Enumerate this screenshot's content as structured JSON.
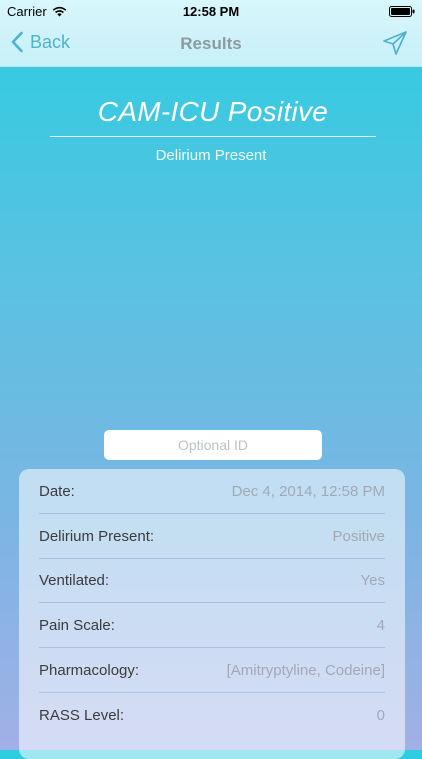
{
  "status_bar": {
    "carrier": "Carrier",
    "time": "12:58 PM"
  },
  "nav": {
    "back_label": "Back",
    "title": "Results"
  },
  "result": {
    "title": "CAM-ICU Positive",
    "subtitle": "Delirium Present"
  },
  "optional_id": {
    "placeholder": "Optional ID",
    "value": ""
  },
  "details": [
    {
      "label": "Date:",
      "value": "Dec 4, 2014, 12:58 PM"
    },
    {
      "label": "Delirium Present:",
      "value": "Positive"
    },
    {
      "label": "Ventilated:",
      "value": "Yes"
    },
    {
      "label": "Pain Scale:",
      "value": "4"
    },
    {
      "label": "Pharmacology:",
      "value": "[Amitryptyline, Codeine]"
    },
    {
      "label": "RASS Level:",
      "value": "0"
    }
  ],
  "icons": {
    "back": "chevron-left-icon",
    "send": "send-icon",
    "wifi": "wifi-icon",
    "battery": "battery-icon"
  },
  "colors": {
    "accent": "#4fb2cc",
    "nav_title": "#8c9aa0",
    "gradient_top": "#2ccde0",
    "gradient_bottom": "#a2b0e6"
  }
}
